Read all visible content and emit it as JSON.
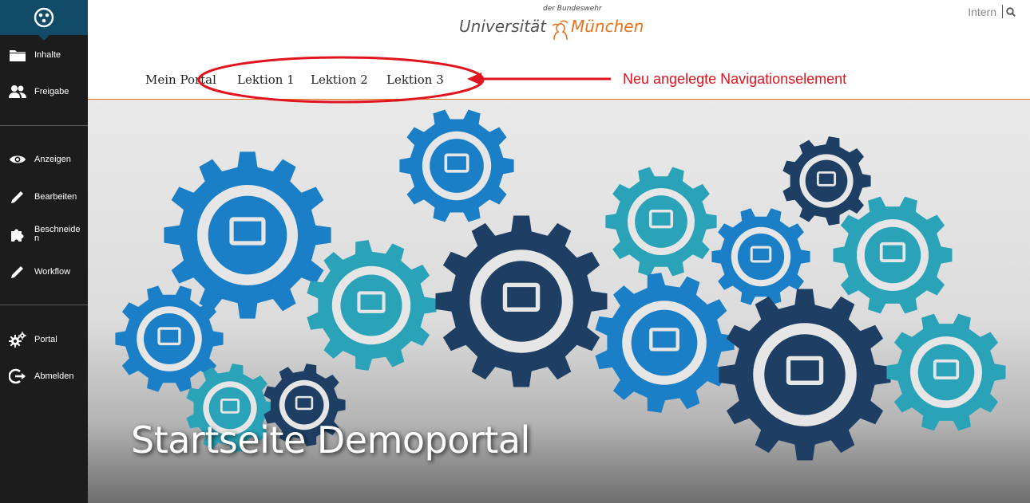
{
  "sidebar": {
    "items": [
      {
        "label": "Inhalte",
        "icon": "folder-icon"
      },
      {
        "label": "Freigabe",
        "icon": "users-icon"
      },
      {
        "label": "Anzeigen",
        "icon": "eye-icon"
      },
      {
        "label": "Bearbeiten",
        "icon": "pencil-icon"
      },
      {
        "label": "Beschneiden",
        "icon": "puzzle-icon"
      },
      {
        "label": "Workflow",
        "icon": "pencil-icon"
      },
      {
        "label": "Portal",
        "icon": "gears-icon"
      },
      {
        "label": "Abmelden",
        "icon": "logout-icon"
      }
    ]
  },
  "header": {
    "logo": {
      "subtitle": "der Bundeswehr",
      "word1": "Universität",
      "word2": "München"
    },
    "intern_label": "Intern",
    "nav": [
      "Mein Portal",
      "Lektion 1",
      "Lektion 2",
      "Lektion 3"
    ],
    "accent_color": "#e8721c"
  },
  "annotation": {
    "text": "Neu angelegte Navigationselement",
    "color": "#e0141e"
  },
  "hero": {
    "title": "Startseite Demoportal"
  }
}
